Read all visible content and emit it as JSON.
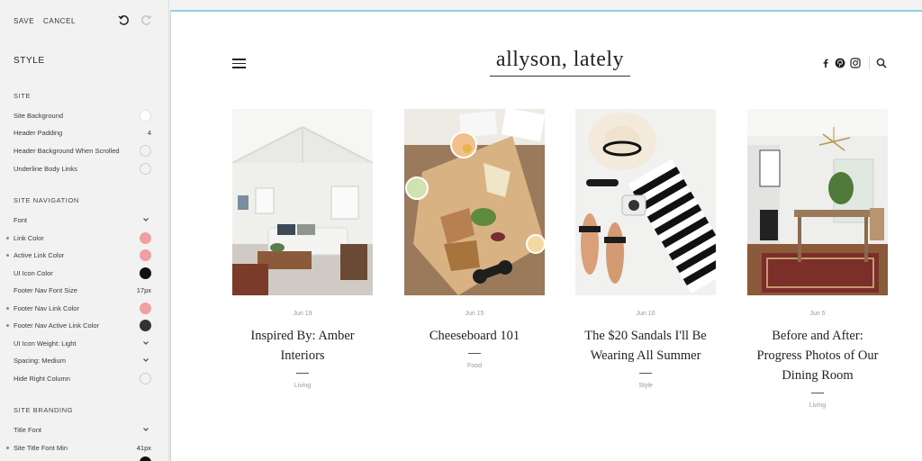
{
  "toolbar": {
    "save": "SAVE",
    "cancel": "CANCEL"
  },
  "panel": {
    "title": "STYLE",
    "sections": {
      "site": {
        "heading": "SITE",
        "items": [
          {
            "label": "Site Background",
            "control": "swatch",
            "color": "#ffffff"
          },
          {
            "label": "Header Padding",
            "control": "value",
            "value": "4"
          },
          {
            "label": "Header Background When Scrolled",
            "control": "toggle"
          },
          {
            "label": "Underline Body Links",
            "control": "toggle"
          }
        ]
      },
      "nav": {
        "heading": "SITE NAVIGATION",
        "items": [
          {
            "label": "Font",
            "control": "dropdown"
          },
          {
            "label": "Link Color",
            "control": "swatch",
            "color": "#f0a0a0",
            "marked": true
          },
          {
            "label": "Active Link Color",
            "control": "swatch",
            "color": "#f0a0a0",
            "marked": true
          },
          {
            "label": "UI Icon Color",
            "control": "swatch",
            "color": "#111111"
          },
          {
            "label": "Footer Nav Font Size",
            "control": "value",
            "value": "17px"
          },
          {
            "label": "Footer Nav Link Color",
            "control": "swatch",
            "color": "#f0a0a0",
            "marked": true
          },
          {
            "label": "Footer Nav Active Link Color",
            "control": "swatch",
            "color": "#333333",
            "marked": true
          },
          {
            "label": "UI Icon Weight: Light",
            "control": "dropdown"
          },
          {
            "label": "Spacing: Medium",
            "control": "dropdown"
          },
          {
            "label": "Hide Right Column",
            "control": "toggle"
          }
        ]
      },
      "branding": {
        "heading": "SITE BRANDING",
        "items": [
          {
            "label": "Title Font",
            "control": "dropdown"
          },
          {
            "label": "Site Title Font Min",
            "control": "value",
            "value": "41px",
            "marked": true
          }
        ]
      }
    }
  },
  "site": {
    "title": "allyson, lately",
    "social_icons": [
      "facebook-icon",
      "pinterest-icon",
      "instagram-icon"
    ],
    "posts": [
      {
        "date": "Jun 19",
        "title_lines": [
          "Inspired By: Amber",
          "Interiors"
        ],
        "category": "Living",
        "image": "living-room-photo"
      },
      {
        "date": "Jun 15",
        "title_lines": [
          "Cheeseboard 101"
        ],
        "category": "Food",
        "image": "cheeseboard-photo"
      },
      {
        "date": "Jun 10",
        "title_lines": [
          "The $20 Sandals I'll Be",
          "Wearing All Summer"
        ],
        "category": "Style",
        "image": "sandals-flatlay-photo"
      },
      {
        "date": "Jun 5",
        "title_lines": [
          "Before and After:",
          "Progress Photos of Our",
          "Dining Room"
        ],
        "category": "Living",
        "image": "dining-room-photo"
      }
    ]
  },
  "colors": {
    "accent_pink": "#f0a0a0",
    "preview_border": "#8fd0e6"
  }
}
